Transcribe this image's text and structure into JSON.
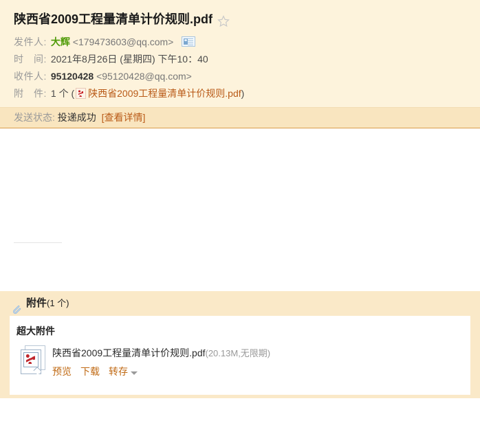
{
  "mail": {
    "title": "陕西省2009工程量清单计价规则.pdf",
    "star_icon": "star-outline-icon",
    "fields": {
      "sender_label": "发件人:",
      "sender_name": "大辉",
      "sender_address": "<179473603@qq.com>",
      "vcard_icon": "contact-card-icon",
      "time_label": "时　间:",
      "time_value": "2021年8月26日 (星期四) 下午10：40",
      "recipient_label": "收件人:",
      "recipient_name": "95120428",
      "recipient_address": "<95120428@qq.com>",
      "attachment_label": "附　件:",
      "attachment_count": "1 个",
      "attachment_paren_open": "(",
      "attachment_paren_close": ")",
      "attachment_icon": "pdf-file-icon",
      "attachment_name": "陕西省2009工程量清单计价规则.pdf"
    },
    "status": {
      "label": "发送状态:",
      "value": "投递成功",
      "detail_link": "[查看详情]"
    }
  },
  "attachments_section": {
    "clip_icon": "paperclip-icon",
    "heading": "附件",
    "count_text": "(1 个)",
    "panel_title": "超大附件",
    "items": [
      {
        "icon": "pdf-file-icon",
        "name": "陕西省2009工程量清单计价规则.pdf",
        "meta": "(20.13M,无限期)",
        "actions": [
          "预览",
          "下载",
          "转存"
        ],
        "more_icon": "caret-down-icon"
      }
    ]
  },
  "colors": {
    "header_bg": "#fdf3dc",
    "status_bg": "#f9e5bf",
    "status_border": "#d99c4a",
    "attach_bar_bg": "#fae9c8",
    "sender_green": "#4e9a06",
    "link_orange": "#b95a17",
    "action_orange": "#c06a14",
    "muted_gray": "#9a9a9a"
  }
}
